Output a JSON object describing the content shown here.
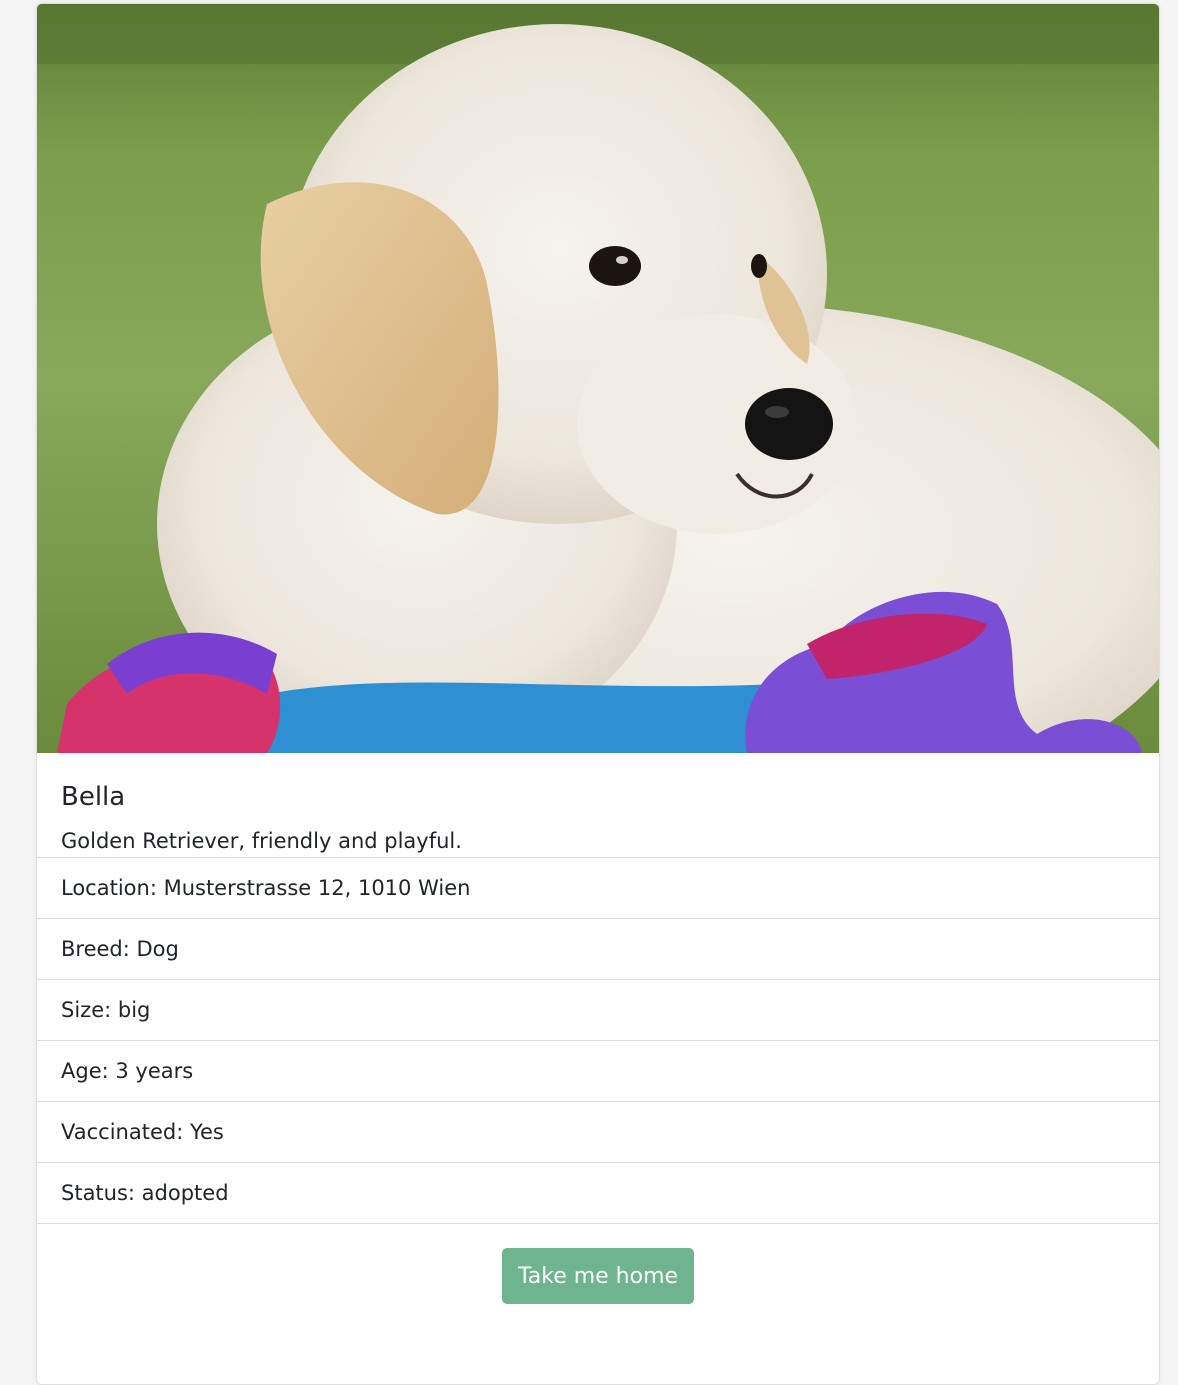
{
  "pet": {
    "name": "Bella",
    "description": "Golden Retriever, friendly and playful."
  },
  "details": [
    {
      "text": "Location: Musterstrasse 12, 1010 Wien"
    },
    {
      "text": "Breed: Dog"
    },
    {
      "text": "Size: big"
    },
    {
      "text": "Age: 3 years"
    },
    {
      "text": "Vaccinated: Yes"
    },
    {
      "text": "Status: adopted"
    }
  ],
  "action": {
    "label": "Take me home",
    "color": "#6db48f"
  },
  "image": {
    "icon": "puppy-photo"
  }
}
